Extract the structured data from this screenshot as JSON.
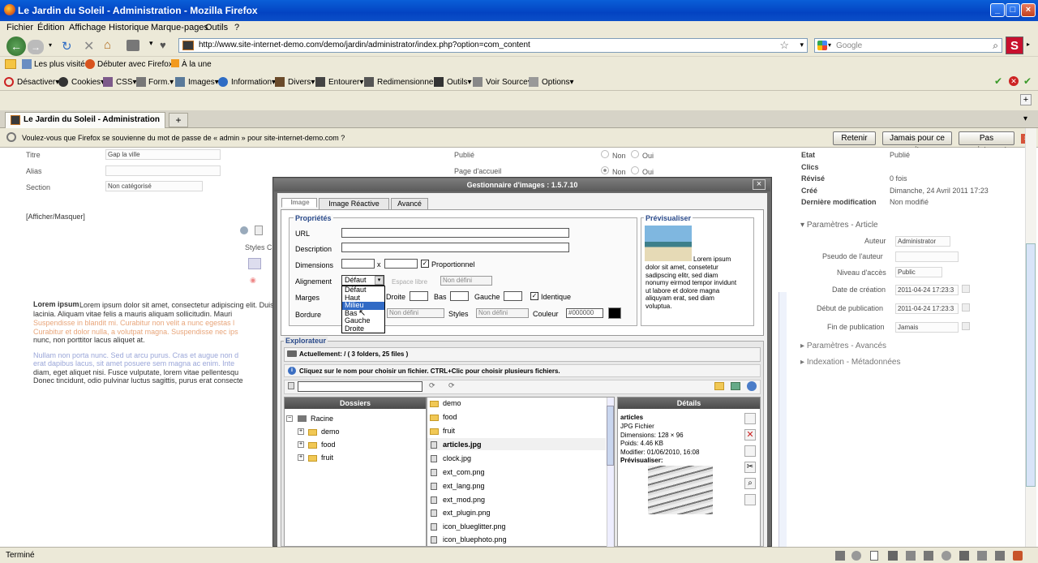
{
  "window": {
    "title": "Le Jardin du Soleil - Administration - Mozilla Firefox"
  },
  "menu": [
    "Fichier",
    "Édition",
    "Affichage",
    "Historique",
    "Marque-pages",
    "Outils",
    "?"
  ],
  "nav": {
    "url": "http://www.site-internet-demo.com/demo/jardin/administrator/index.php?option=com_content",
    "search_placeholder": "Google"
  },
  "bookmarks": [
    "Les plus visités",
    "Débuter avec Firefox",
    "À la une"
  ],
  "devbar": [
    "Désactiver▾",
    "Cookies▾",
    "CSS▾",
    "Form.▾",
    "Images▾",
    "Information▾",
    "Divers▾",
    "Entourer▾",
    "Redimensionner▾",
    "Outils▾",
    "Voir Source▾",
    "Options▾"
  ],
  "tab": {
    "label": "Le Jardin du Soleil - Administration",
    "new": "+"
  },
  "notification": {
    "text": "Voulez-vous que Firefox se souvienne du mot de passe de « admin » pour site-internet-demo.com ?",
    "btn_remember": "Retenir",
    "btn_never": "Jamais pour ce site",
    "btn_not_now": "Pas maintenant"
  },
  "article": {
    "titre_label": "Titre",
    "titre_value": "Gap la ville",
    "alias_label": "Alias",
    "section_label": "Section",
    "section_value": "Non catégorisé",
    "publie_label": "Publié",
    "accueil_label": "Page d'accueil",
    "non": "Non",
    "oui": "Oui",
    "toggle": "[Afficher/Masquer]",
    "styles": "Styles CS",
    "lorem1": "Lorem ipsum dolor sit amet, consectetur adipiscing elit. Duis",
    "lorem2": "lacinia. Aliquam vitae felis a mauris aliquam sollicitudin. Mauri",
    "lorem3": "Suspendisse in blandit mi. Curabitur non velit a nunc egestas l",
    "lorem4": "Curabitur et dolor nulla, a volutpat magna. Suspendisse nec ips",
    "lorem5": "nunc, non porttitor lacus aliquet at.",
    "lorem6": "Nullam non porta nunc. Sed ut arcu purus. Cras et augue non d",
    "lorem7": "erat dapibus lacus, sit amet posuere sem magna ac enim. Inte",
    "lorem8": "diam, eget aliquet nisi. Fusce vulputate, lorem vitae pellentesqu",
    "lorem9": "Donec tincidunt, odio pulvinar luctus sagittis, purus erat consecte"
  },
  "info": {
    "etat_l": "Etat",
    "etat_v": "Publié",
    "clics_l": "Clics",
    "revise_l": "Révisé",
    "revise_v": "0 fois",
    "cree_l": "Créé",
    "cree_v": "Dimanche, 24 Avril 2011 17:23",
    "modif_l": "Dernière modification",
    "modif_v": "Non modifié"
  },
  "params": {
    "title": "Paramètres - Article",
    "auteur_l": "Auteur",
    "auteur_v": "Administrator",
    "pseudo_l": "Pseudo de l'auteur",
    "niveau_l": "Niveau d'accès",
    "niveau_v": "Public",
    "date_l": "Date de création",
    "date_v": "2011-04-24 17:23:3",
    "debut_l": "Début de publication",
    "debut_v": "2011-04-24 17:23:3",
    "fin_l": "Fin de publication",
    "fin_v": "Jamais",
    "avances": "Paramètres - Avancés",
    "meta": "Indexation - Métadonnées"
  },
  "dialog": {
    "title": "Gestionnaire d'images : 1.5.7.10",
    "close": "×",
    "tabs": [
      "Image",
      "Image Réactive",
      "Avancé"
    ],
    "props_legend": "Propriétés",
    "url_l": "URL",
    "desc_l": "Description",
    "dim_l": "Dimensions",
    "x": "x",
    "prop_l": "Proportionnel",
    "align_l": "Alignement",
    "align_v": "Défaut",
    "espace_l": "Espace libre",
    "nondef": "Non défini",
    "marges_l": "Marges",
    "droite_l": "Droite",
    "bas_l": "Bas",
    "gauche_l": "Gauche",
    "ident_l": "Identique",
    "bordure_l": "Bordure",
    "styles_l": "Styles",
    "couleur_l": "Couleur",
    "couleur_v": "#000000",
    "dropdown": [
      "Défaut",
      "Haut",
      "Milieu",
      "Bas",
      "Gauche",
      "Droite"
    ],
    "preview_legend": "Prévisualiser",
    "preview_text": [
      "Lorem ipsum",
      "dolor sit amet, consetetur",
      "sadipscing elitr, sed diam",
      "nonumy eirmod tempor invidunt",
      "ut labore et dolore magna",
      "aliquyam erat, sed diam",
      "voluptua."
    ],
    "explorer_legend": "Explorateur",
    "current": "Actuellement: / ( 3 folders, 25 files )",
    "hint": "Cliquez sur le nom pour choisir un fichier. CTRL+Clic pour choisir plusieurs fichiers.",
    "folders_head": "Dossiers",
    "tree": [
      "Racine",
      "demo",
      "food",
      "fruit"
    ],
    "files": [
      "demo",
      "food",
      "fruit",
      "articles.jpg",
      "clock.jpg",
      "ext_com.png",
      "ext_lang.png",
      "ext_mod.png",
      "ext_plugin.png",
      "icon_blueglitter.png",
      "icon_bluephoto.png"
    ],
    "details_head": "Détails",
    "details": {
      "name": "articles",
      "type": "JPG Fichier",
      "dims": "Dimensions: 128 × 96",
      "poids": "Poids: 4.46 KB",
      "modif": "Modifier: 01/06/2010, 16:08",
      "prev": "Prévisualiser:"
    }
  },
  "status": {
    "text": "Terminé"
  }
}
